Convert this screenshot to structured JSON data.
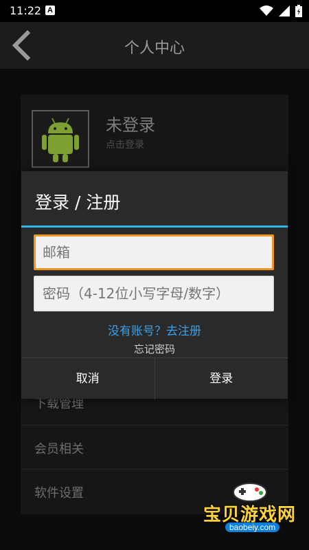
{
  "status": {
    "time": "11:22",
    "notification_glyph": "A"
  },
  "header": {
    "title": "个人中心"
  },
  "profile": {
    "name": "未登录",
    "subtitle": "点击登录"
  },
  "menu": {
    "items": [
      "下载管理",
      "会员相关",
      "软件设置"
    ]
  },
  "dialog": {
    "title": "登录 / 注册",
    "email_placeholder": "邮箱",
    "password_placeholder": "密码（4-12位小写字母/数字）",
    "register_link": "没有账号？去注册",
    "forgot_link": "忘记密码",
    "cancel_label": "取消",
    "login_label": "登录"
  },
  "watermark": {
    "text": "宝贝游戏网",
    "url": "baobeiy.com"
  },
  "colors": {
    "accent": "#33b5e5",
    "focus": "#f0951f",
    "link": "#3aa0ea"
  }
}
